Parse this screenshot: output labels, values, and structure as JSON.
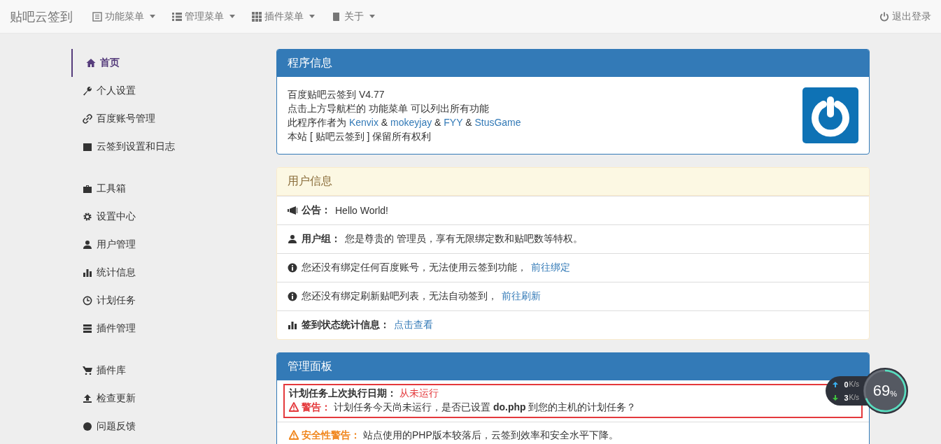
{
  "navbar": {
    "brand": "贴吧云签到",
    "menus": [
      {
        "label": "功能菜单"
      },
      {
        "label": "管理菜单"
      },
      {
        "label": "插件菜单"
      },
      {
        "label": "关于"
      }
    ],
    "logout": "退出登录"
  },
  "sidebar": {
    "groups": [
      [
        {
          "label": "首页",
          "selected": true
        },
        {
          "label": "个人设置",
          "selected": false
        },
        {
          "label": "百度账号管理",
          "selected": false
        },
        {
          "label": "云签到设置和日志",
          "selected": false
        }
      ],
      [
        {
          "label": "工具箱",
          "selected": false
        },
        {
          "label": "设置中心",
          "selected": false
        },
        {
          "label": "用户管理",
          "selected": false
        },
        {
          "label": "统计信息",
          "selected": false
        },
        {
          "label": "计划任务",
          "selected": false
        },
        {
          "label": "插件管理",
          "selected": false
        }
      ],
      [
        {
          "label": "插件库",
          "selected": false
        },
        {
          "label": "检查更新",
          "selected": false
        },
        {
          "label": "问题反馈",
          "selected": false
        }
      ]
    ]
  },
  "program_info": {
    "title": "程序信息",
    "lines": [
      [
        {
          "text": "百度贴吧云签到 V4.77"
        }
      ],
      [
        {
          "text": "点击上方导航栏的 功能菜单 可以列出所有功能"
        }
      ],
      [
        {
          "text": "此程序作者为 "
        },
        {
          "link": "Kenvix"
        },
        {
          "text": " & "
        },
        {
          "link": "mokeyjay"
        },
        {
          "text": " & "
        },
        {
          "link": "FYY"
        },
        {
          "text": " & "
        },
        {
          "link": "StusGame"
        }
      ],
      [
        {
          "text": "本站 [ 贴吧云签到 ] 保留所有权利"
        }
      ]
    ]
  },
  "user_info": {
    "title": "用户信息",
    "rows": [
      {
        "kind": "announce",
        "label": "公告：",
        "text": "Hello World!"
      },
      {
        "kind": "group",
        "label": "用户组：",
        "text": "您是尊贵的 管理员，享有无限绑定数和贴吧数等特权。"
      },
      {
        "kind": "info",
        "text": "您还没有绑定任何百度账号，无法使用云签到功能，",
        "link": "前往绑定"
      },
      {
        "kind": "info",
        "text": "您还没有绑定刷新贴吧列表，无法自动签到，",
        "link": "前往刷新"
      },
      {
        "kind": "stats",
        "label": "签到状态统计信息：",
        "link": "点击查看"
      }
    ]
  },
  "admin_panel": {
    "title": "管理面板",
    "rows": [
      {
        "highlighted": true,
        "lines": [
          {
            "kind": "date",
            "label": "计划任务上次执行日期：",
            "value": "从未运行"
          },
          {
            "kind": "danger",
            "label": "警告：",
            "text": "计划任务今天尚未运行，是否已设置 **do.php** 到您的主机的计划任务？"
          }
        ]
      },
      {
        "highlighted": false,
        "lines": [
          {
            "kind": "warning",
            "label": "安全性警告：",
            "text": "站点使用的PHP版本较落后，云签到效率和安全水平下降。"
          }
        ]
      }
    ]
  },
  "net_widget": {
    "upload": "0",
    "upload_unit": "K/s",
    "download": "3",
    "download_unit": "K/s",
    "percent": "69",
    "percent_unit": "%"
  }
}
